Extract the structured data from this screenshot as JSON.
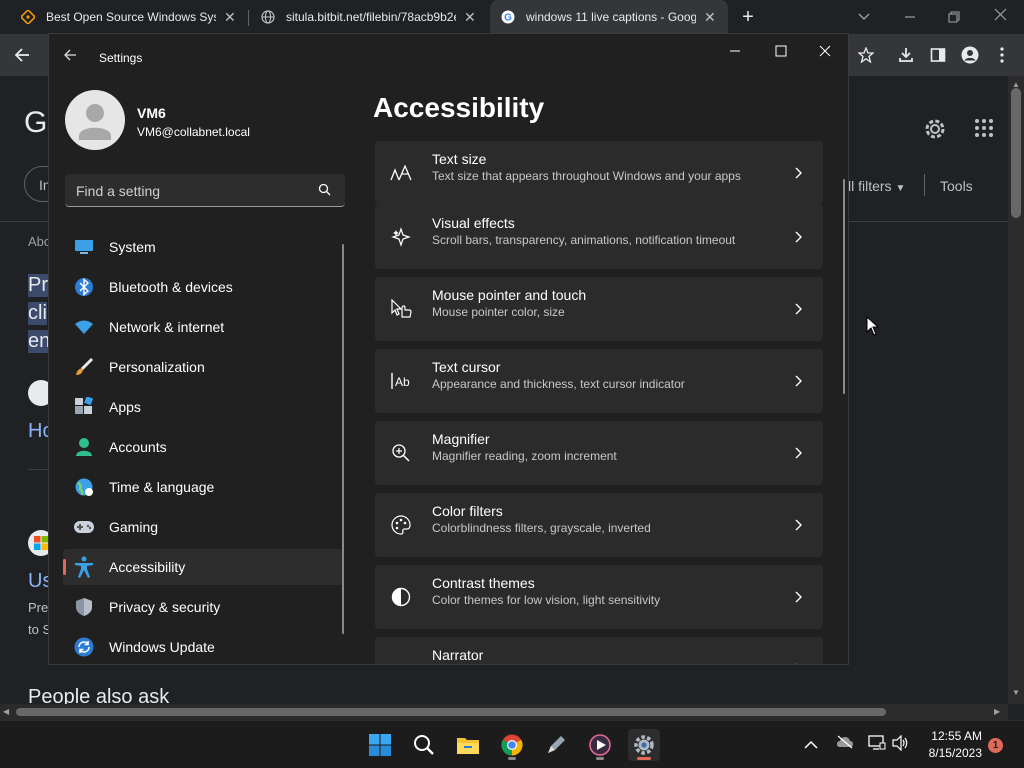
{
  "browser": {
    "tabs": [
      {
        "title": "Best Open Source Windows Syste",
        "active": false
      },
      {
        "title": "situla.bitbit.net/filebin/78acb9b2e",
        "active": false
      },
      {
        "title": "windows 11 live captions - Goog",
        "active": true
      }
    ],
    "new_tab": "+"
  },
  "google_page": {
    "logo_letter": "G",
    "filters_label": "ll filters",
    "tools_label": "Tools",
    "about_text": "Abo",
    "snippet_lines": [
      "Pr",
      "cli",
      "en"
    ],
    "link_ho": "Ho",
    "link_us": "Us",
    "snippet2_lines": [
      "Pre",
      "to S"
    ],
    "in_label": "In",
    "people_also_ask": "People also ask"
  },
  "settings": {
    "window_title": "Settings",
    "user": {
      "name": "VM6",
      "email": "VM6@collabnet.local"
    },
    "search": {
      "placeholder": "Find a setting"
    },
    "nav": [
      {
        "label": "System",
        "icon": "system-icon",
        "selected": false
      },
      {
        "label": "Bluetooth & devices",
        "icon": "bluetooth-icon",
        "selected": false
      },
      {
        "label": "Network & internet",
        "icon": "network-icon",
        "selected": false
      },
      {
        "label": "Personalization",
        "icon": "brush-icon",
        "selected": false
      },
      {
        "label": "Apps",
        "icon": "apps-icon",
        "selected": false
      },
      {
        "label": "Accounts",
        "icon": "accounts-icon",
        "selected": false
      },
      {
        "label": "Time & language",
        "icon": "globe-clock-icon",
        "selected": false
      },
      {
        "label": "Gaming",
        "icon": "gamepad-icon",
        "selected": false
      },
      {
        "label": "Accessibility",
        "icon": "accessibility-icon",
        "selected": true
      },
      {
        "label": "Privacy & security",
        "icon": "shield-icon",
        "selected": false
      },
      {
        "label": "Windows Update",
        "icon": "update-icon",
        "selected": false
      }
    ],
    "page_title": "Accessibility",
    "cards": [
      {
        "title": "Text size",
        "subtitle": "Text size that appears throughout Windows and your apps",
        "icon": "text-size-icon"
      },
      {
        "title": "Visual effects",
        "subtitle": "Scroll bars, transparency, animations, notification timeout",
        "icon": "sparkle-icon"
      },
      {
        "title": "Mouse pointer and touch",
        "subtitle": "Mouse pointer color, size",
        "icon": "pointer-icon"
      },
      {
        "title": "Text cursor",
        "subtitle": "Appearance and thickness, text cursor indicator",
        "icon": "text-cursor-icon"
      },
      {
        "title": "Magnifier",
        "subtitle": "Magnifier reading, zoom increment",
        "icon": "magnifier-icon"
      },
      {
        "title": "Color filters",
        "subtitle": "Colorblindness filters, grayscale, inverted",
        "icon": "palette-icon"
      },
      {
        "title": "Contrast themes",
        "subtitle": "Color themes for low vision, light sensitivity",
        "icon": "contrast-icon"
      },
      {
        "title": "Narrator",
        "subtitle": "",
        "icon": "narrator-icon"
      }
    ]
  },
  "taskbar": {
    "time": "12:55 AM",
    "date": "8/15/2023",
    "notification_count": "1"
  },
  "colors": {
    "accent": "#e06a5a",
    "settings_bg": "#202020",
    "card_bg": "#2b2b2b"
  }
}
